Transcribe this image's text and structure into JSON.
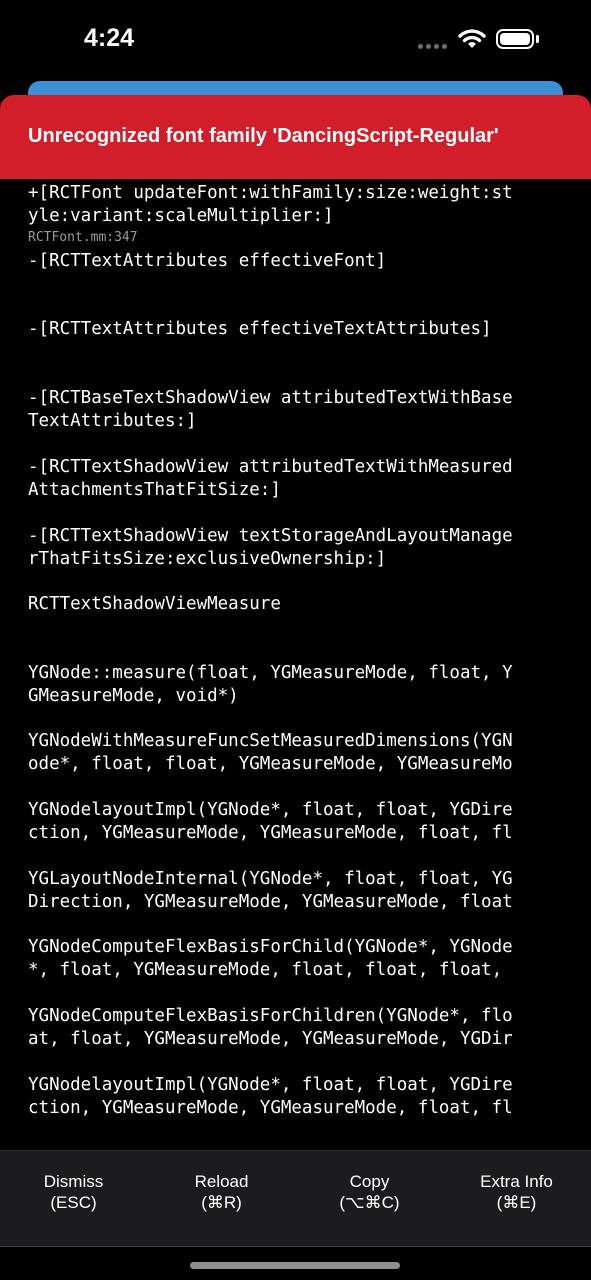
{
  "status_bar": {
    "time": "4:24",
    "icons": [
      "signal-dots-icon",
      "wifi-icon",
      "battery-icon"
    ]
  },
  "error": {
    "title": "Unrecognized font family 'DancingScript-Regular'",
    "header_color": "#d21e2b"
  },
  "stack": [
    {
      "lines": [
        "+[RCTFont updateFont:withFamily:size:weight:st",
        "yle:variant:scaleMultiplier:]"
      ],
      "file": "RCTFont.mm:347"
    },
    {
      "lines": [
        "-[RCTTextAttributes effectiveFont]"
      ],
      "file": ""
    },
    {
      "lines": [
        "-[RCTTextAttributes effectiveTextAttributes]"
      ],
      "file": ""
    },
    {
      "lines": [
        "-[RCTBaseTextShadowView attributedTextWithBase",
        "TextAttributes:]"
      ],
      "file": ""
    },
    {
      "lines": [
        "-[RCTTextShadowView attributedTextWithMeasured",
        "AttachmentsThatFitSize:]"
      ],
      "file": ""
    },
    {
      "lines": [
        "-[RCTTextShadowView textStorageAndLayoutManage",
        "rThatFitsSize:exclusiveOwnership:]"
      ],
      "file": ""
    },
    {
      "lines": [
        "RCTTextShadowViewMeasure"
      ],
      "file": ""
    },
    {
      "lines": [
        "YGNode::measure(float, YGMeasureMode, float, Y",
        "GMeasureMode, void*)"
      ],
      "file": ""
    },
    {
      "lines": [
        "YGNodeWithMeasureFuncSetMeasuredDimensions(YGN",
        "ode*, float, float, YGMeasureMode, YGMeasureMo"
      ],
      "file": ""
    },
    {
      "lines": [
        "YGNodelayoutImpl(YGNode*, float, float, YGDire",
        "ction, YGMeasureMode, YGMeasureMode, float, fl"
      ],
      "file": ""
    },
    {
      "lines": [
        "YGLayoutNodeInternal(YGNode*, float, float, YG",
        "Direction, YGMeasureMode, YGMeasureMode, float"
      ],
      "file": ""
    },
    {
      "lines": [
        "YGNodeComputeFlexBasisForChild(YGNode*, YGNode",
        "*, float, YGMeasureMode, float, float, float,"
      ],
      "file": ""
    },
    {
      "lines": [
        "YGNodeComputeFlexBasisForChildren(YGNode*, flo",
        "at, float, YGMeasureMode, YGMeasureMode, YGDir"
      ],
      "file": ""
    },
    {
      "lines": [
        "YGNodelayoutImpl(YGNode*, float, float, YGDire",
        "ction, YGMeasureMode, YGMeasureMode, float, fl"
      ],
      "file": ""
    }
  ],
  "toolbar": {
    "dismiss": {
      "label": "Dismiss",
      "shortcut": "(ESC)"
    },
    "reload": {
      "label": "Reload",
      "shortcut": "(⌘R)"
    },
    "copy": {
      "label": "Copy",
      "shortcut": "(⌥⌘C)"
    },
    "extra": {
      "label": "Extra Info",
      "shortcut": "(⌘E)"
    }
  }
}
